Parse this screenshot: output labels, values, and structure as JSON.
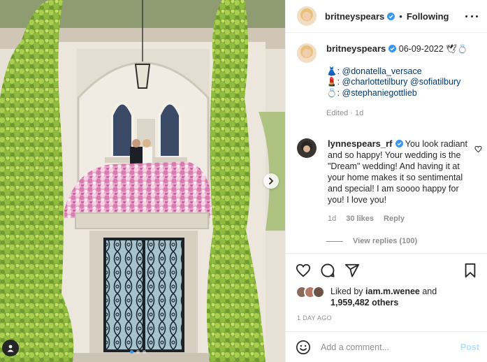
{
  "header": {
    "username": "britneyspears",
    "separator": "•",
    "follow_state": "Following",
    "more_icon": "more-horizontal-icon"
  },
  "caption": {
    "username": "britneyspears",
    "date": "06-09-2022",
    "emoji": "🕊💍",
    "credits": [
      {
        "emoji": "👗",
        "handles": [
          "@donatella_versace"
        ]
      },
      {
        "emoji": "💄",
        "handles": [
          "@charlottetilbury",
          "@sofiatilbury"
        ]
      },
      {
        "emoji": "💍",
        "handles": [
          "@stephaniegottlieb"
        ]
      }
    ],
    "edited": "Edited · 1d"
  },
  "comment": {
    "username": "lynnespears_rf",
    "text": "You look radiant and so happy! Your wedding is the \"Dream\" wedding! And having it at your home makes it so sentimental and special! I am soooo happy for you! I love you!",
    "time": "1d",
    "likes": "30 likes",
    "reply": "Reply",
    "view_replies": "View replies (100)"
  },
  "likes": {
    "prefix": "Liked by",
    "user": "iam.m.wenee",
    "and": "and",
    "others": "1,959,482 others"
  },
  "timestamp": "1 DAY AGO",
  "add_comment": {
    "placeholder": "Add a comment...",
    "post_label": "Post"
  },
  "carousel": {
    "slides": 3,
    "active_index": 0
  },
  "colors": {
    "verified": "#3897f0",
    "mention": "#00376b",
    "secondary_text": "#8e8e8e",
    "post_disabled": "#b2dffc",
    "border": "#efefef"
  }
}
